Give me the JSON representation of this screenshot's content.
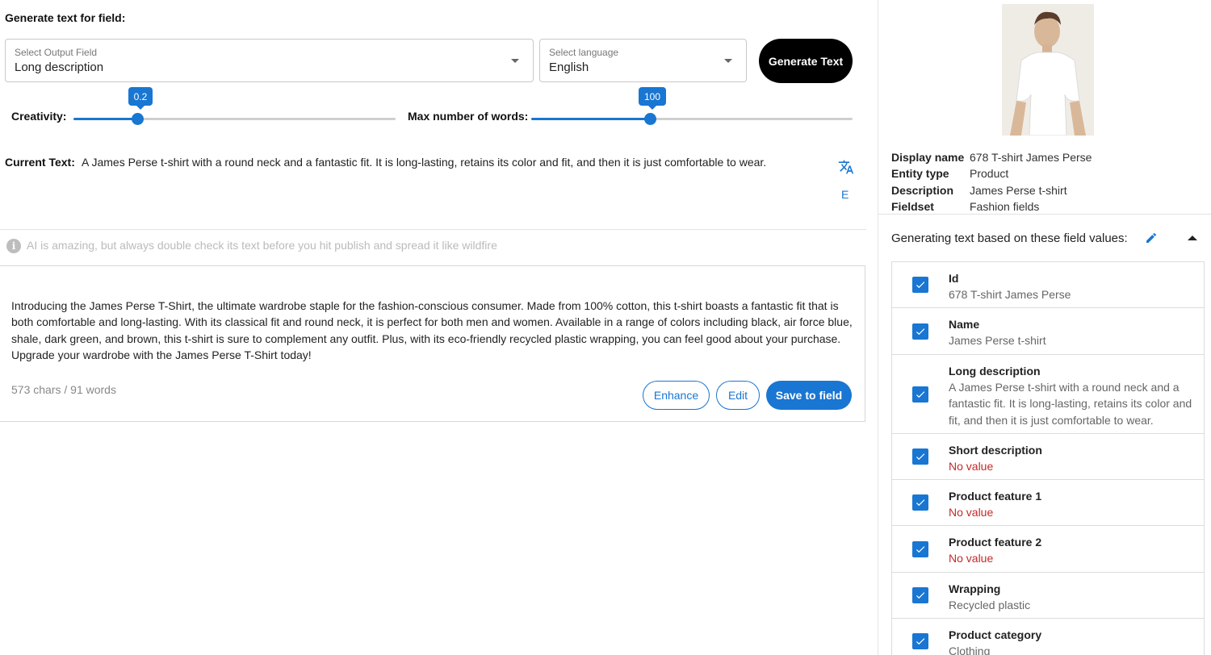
{
  "header": {
    "title": "Generate text for field:"
  },
  "output_field": {
    "label": "Select Output Field",
    "value": "Long description"
  },
  "language": {
    "label": "Select language",
    "value": "English"
  },
  "generate_button": "Generate Text",
  "creativity": {
    "label": "Creativity:",
    "value": "0.2",
    "fraction": 0.2
  },
  "max_words": {
    "label": "Max number of words:",
    "value": "100",
    "fraction": 0.374
  },
  "current": {
    "label": "Current Text:",
    "text": "A James Perse t-shirt with a round neck and a fantastic fit. It is long-lasting, retains its color and fit, and then it is just comfortable to wear.",
    "e_label": "E"
  },
  "info": {
    "text": "AI is amazing, but always double check its text before you hit publish and spread it like wildfire"
  },
  "result": {
    "text": "Introducing the James Perse T-Shirt, the ultimate wardrobe staple for the fashion-conscious consumer. Made from 100% cotton, this t-shirt boasts a fantastic fit that is both comfortable and long-lasting. With its classical fit and round neck, it is perfect for both men and women. Available in a range of colors including black, air force blue, shale, dark green, and brown, this t-shirt is sure to complement any outfit. Plus, with its eco-friendly recycled plastic wrapping, you can feel good about your purchase. Upgrade your wardrobe with the James Perse T-Shirt today!",
    "counter": "573 chars / 91 words",
    "enhance": "Enhance",
    "edit": "Edit",
    "save": "Save to field"
  },
  "entity": {
    "props": [
      {
        "key": "Display name",
        "value": "678 T-shirt James Perse"
      },
      {
        "key": "Entity type",
        "value": "Product"
      },
      {
        "key": "Description",
        "value": "James Perse t-shirt"
      },
      {
        "key": "Fieldset",
        "value": "Fashion fields"
      }
    ],
    "generating_title": "Generating text based on these field values:",
    "fields": [
      {
        "name": "Id",
        "value": "678 T-shirt James Perse",
        "empty": false
      },
      {
        "name": "Name",
        "value": "James Perse t-shirt",
        "empty": false
      },
      {
        "name": "Long description",
        "value": "A James Perse t-shirt with a round neck and a fantastic fit. It is long-lasting, retains its color and fit, and then it is just comfortable to wear.",
        "empty": false
      },
      {
        "name": "Short description",
        "value": "No value",
        "empty": true
      },
      {
        "name": "Product feature 1",
        "value": "No value",
        "empty": true
      },
      {
        "name": "Product feature 2",
        "value": "No value",
        "empty": true
      },
      {
        "name": "Wrapping",
        "value": "Recycled plastic",
        "empty": false
      },
      {
        "name": "Product category",
        "value": "Clothing",
        "empty": false
      }
    ]
  },
  "colors": {
    "accent": "#1976d2",
    "error": "#c62828",
    "black_button": "#000000"
  }
}
